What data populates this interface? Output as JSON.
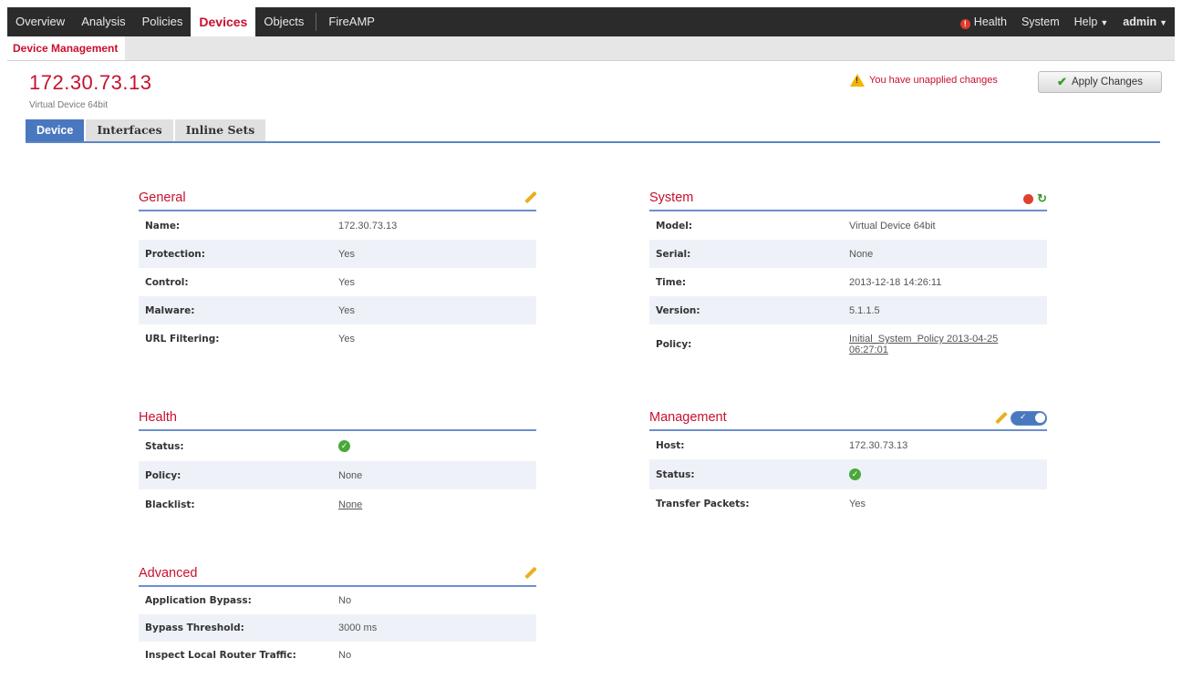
{
  "topnav": {
    "items": [
      "Overview",
      "Analysis",
      "Policies",
      "Devices",
      "Objects",
      "FireAMP"
    ],
    "active": "Devices",
    "health": "Health",
    "system": "System",
    "help": "Help",
    "admin": "admin"
  },
  "subnav": {
    "item": "Device Management"
  },
  "device": {
    "title": "172.30.73.13",
    "subtitle": "Virtual Device 64bit"
  },
  "warning": "You have unapplied changes",
  "apply_label": "Apply Changes",
  "tabs": [
    "Device",
    "Interfaces",
    "Inline Sets"
  ],
  "general": {
    "title": "General",
    "rows": [
      {
        "k": "Name:",
        "v": "172.30.73.13"
      },
      {
        "k": "Protection:",
        "v": "Yes"
      },
      {
        "k": "Control:",
        "v": "Yes"
      },
      {
        "k": "Malware:",
        "v": "Yes"
      },
      {
        "k": "URL Filtering:",
        "v": "Yes"
      }
    ]
  },
  "system": {
    "title": "System",
    "rows": [
      {
        "k": "Model:",
        "v": "Virtual Device 64bit"
      },
      {
        "k": "Serial:",
        "v": "None"
      },
      {
        "k": "Time:",
        "v": "2013-12-18 14:26:11"
      },
      {
        "k": "Version:",
        "v": "5.1.1.5"
      },
      {
        "k": "Policy:",
        "v": "Initial_System_Policy 2013-04-25 06:27:01"
      }
    ]
  },
  "health": {
    "title": "Health",
    "rows": [
      {
        "k": "Status:",
        "v": ""
      },
      {
        "k": "Policy:",
        "v": "None"
      },
      {
        "k": "Blacklist:",
        "v": "None"
      }
    ]
  },
  "management": {
    "title": "Management",
    "rows": [
      {
        "k": "Host:",
        "v": "172.30.73.13"
      },
      {
        "k": "Status:",
        "v": ""
      },
      {
        "k": "Transfer Packets:",
        "v": "Yes"
      }
    ]
  },
  "advanced": {
    "title": "Advanced",
    "rows": [
      {
        "k": "Application Bypass:",
        "v": "No"
      },
      {
        "k": "Bypass Threshold:",
        "v": "3000 ms"
      },
      {
        "k": "Inspect Local Router Traffic:",
        "v": "No"
      }
    ]
  },
  "colors": {
    "accent": "#c8102e",
    "tab_active": "#4a78bf",
    "nav_bg": "#2b2b2b"
  },
  "icons": [
    "pencil-icon",
    "warning-icon",
    "check-icon",
    "status-ok-icon",
    "refresh-icon",
    "toggle-icon"
  ]
}
